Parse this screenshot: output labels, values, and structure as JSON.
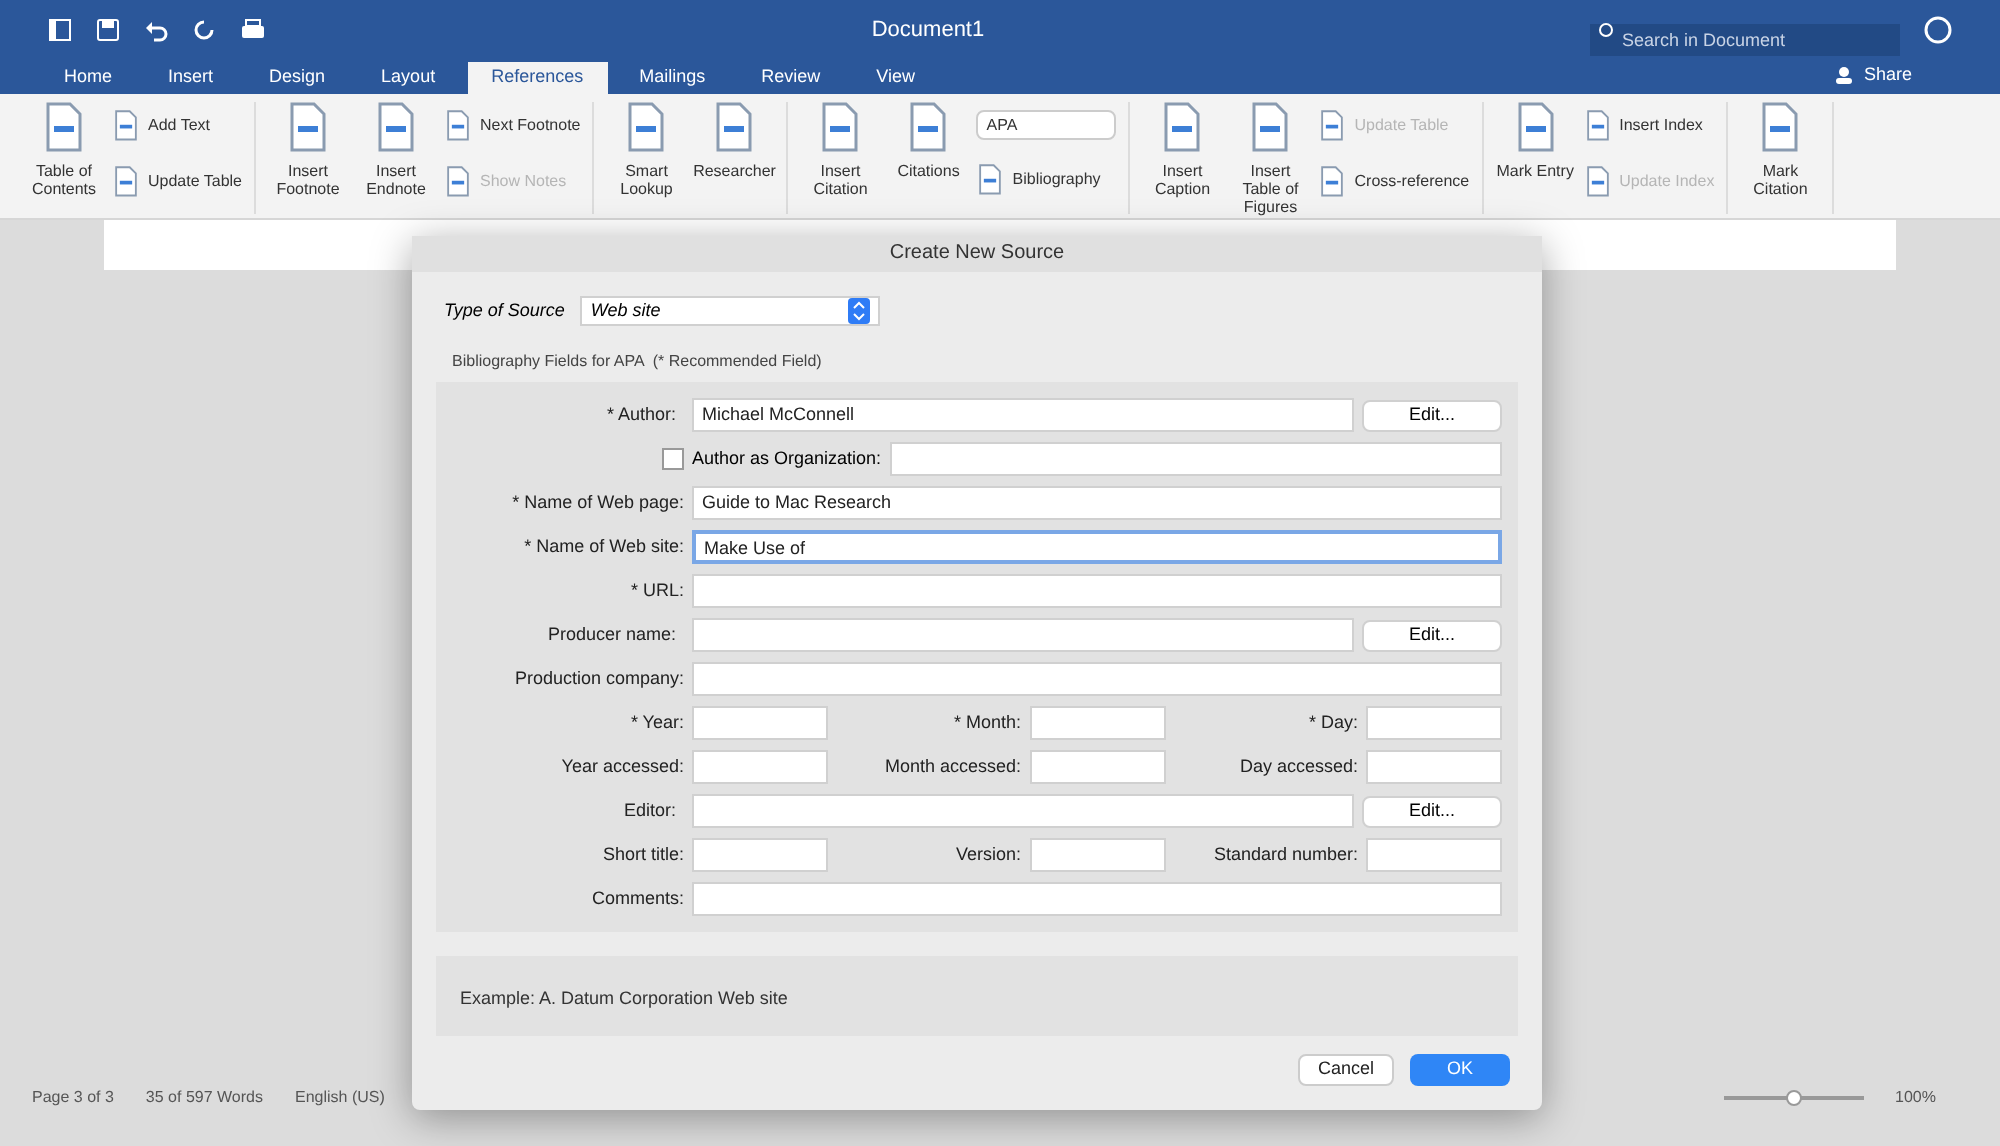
{
  "title_bar": {
    "title": "Document1",
    "search": {
      "placeholder": "Search in Document"
    }
  },
  "tabs": [
    {
      "label": "Home",
      "selected": false
    },
    {
      "label": "Insert",
      "selected": false
    },
    {
      "label": "Design",
      "selected": false
    },
    {
      "label": "Layout",
      "selected": false
    },
    {
      "label": "References",
      "selected": true
    },
    {
      "label": "Mailings",
      "selected": false
    },
    {
      "label": "Review",
      "selected": false
    },
    {
      "label": "View",
      "selected": false
    }
  ],
  "share": "Share",
  "ribbon": [
    {
      "items": [
        {
          "kind": "large",
          "label": "Table of Contents",
          "disabled": false
        },
        {
          "kind": "small",
          "label": "Add Text",
          "disabled": false
        },
        {
          "kind": "small",
          "label": "Update Table",
          "disabled": false
        }
      ]
    },
    {
      "items": [
        {
          "kind": "large",
          "label": "Insert Footnote",
          "disabled": false
        },
        {
          "kind": "large",
          "label": "Insert Endnote",
          "disabled": false
        },
        {
          "kind": "small",
          "label": "Next Footnote",
          "disabled": false
        },
        {
          "kind": "small",
          "label": "Show Notes",
          "disabled": true
        }
      ]
    },
    {
      "items": [
        {
          "kind": "large",
          "label": "Smart Lookup",
          "disabled": false
        },
        {
          "kind": "large",
          "label": "Researcher",
          "disabled": false
        }
      ]
    },
    {
      "items": [
        {
          "kind": "large",
          "label": "Insert Citation",
          "disabled": false
        },
        {
          "kind": "large",
          "label": "Citations",
          "disabled": false
        },
        {
          "kind": "select",
          "label": "APA",
          "disabled": false
        },
        {
          "kind": "small",
          "label": "Bibliography",
          "disabled": false
        }
      ]
    },
    {
      "items": [
        {
          "kind": "large",
          "label": "Insert Caption",
          "disabled": false
        },
        {
          "kind": "large",
          "label": "Insert Table of Figures",
          "disabled": false
        },
        {
          "kind": "small",
          "label": "Update Table",
          "disabled": true
        },
        {
          "kind": "small",
          "label": "Cross-reference",
          "disabled": false
        }
      ]
    },
    {
      "items": [
        {
          "kind": "large",
          "label": "Mark Entry",
          "disabled": false
        },
        {
          "kind": "small",
          "label": "Insert Index",
          "disabled": false
        },
        {
          "kind": "small",
          "label": "Update Index",
          "disabled": true
        }
      ]
    },
    {
      "items": [
        {
          "kind": "large",
          "label": "Mark Citation",
          "disabled": false
        }
      ]
    }
  ],
  "dialog": {
    "title": "Create New Source",
    "type_label": "Type of Source",
    "type_value": "Web site",
    "section_label": "Bibliography Fields for APA",
    "section_note": "(* Recommended Field)",
    "rows": [
      {
        "kind": "wide_button",
        "label": "* Author:",
        "value": "Michael McConnell",
        "button": "Edit...",
        "focused": false
      },
      {
        "kind": "checkbox",
        "label": "Author as Organization:",
        "checked": false
      },
      {
        "kind": "wide",
        "label": "* Name of Web page:",
        "value": "Guide to Mac Research",
        "focused": false
      },
      {
        "kind": "wide",
        "label": "* Name of Web site:",
        "value": "Make Use of",
        "focused": true
      },
      {
        "kind": "wide",
        "label": "* URL:",
        "focused": false
      },
      {
        "kind": "wide_button",
        "label": "Producer name:",
        "button": "Edit...",
        "focused": false
      },
      {
        "kind": "wide",
        "label": "Production company:",
        "focused": false
      },
      {
        "kind": "triple",
        "labels": [
          "* Year:",
          "* Month:",
          "* Day:"
        ]
      },
      {
        "kind": "triple",
        "labels": [
          "Year accessed:",
          "Month accessed:",
          "Day accessed:"
        ]
      },
      {
        "kind": "wide_button",
        "label": "Editor:",
        "button": "Edit...",
        "focused": false
      },
      {
        "kind": "triple",
        "labels": [
          "Short title:",
          "Version:",
          "Standard number:"
        ]
      },
      {
        "kind": "wide",
        "label": "Comments:",
        "focused": false
      }
    ],
    "example": "Example: A. Datum Corporation Web site",
    "buttons": [
      {
        "label": "Cancel",
        "kind": "secondary"
      },
      {
        "label": "OK",
        "kind": "primary"
      }
    ]
  },
  "status_bar": {
    "page": "Page 3 of 3",
    "words": "35 of 597 Words",
    "language": "English (US)",
    "zoom": "100%",
    "zoom_slider": {
      "level": 0.5
    }
  }
}
